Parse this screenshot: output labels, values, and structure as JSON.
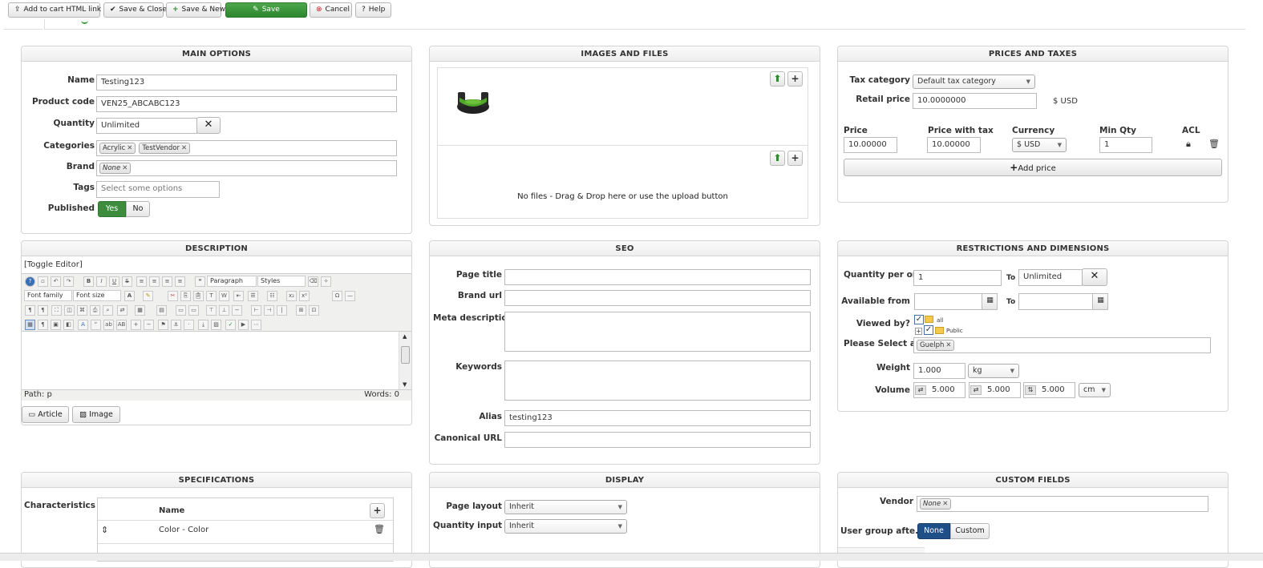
{
  "toolbar": {
    "add_to_cart": "Add to cart HTML link",
    "save_close": "Save & Close",
    "save_new": "Save & New",
    "save": "Save",
    "cancel": "Cancel",
    "help": "Help"
  },
  "main_options": {
    "title": "MAIN OPTIONS",
    "name_label": "Name",
    "name_value": "Testing123",
    "code_label": "Product code",
    "code_value": "VEN25_ABCABC123",
    "qty_label": "Quantity",
    "qty_value": "Unlimited",
    "categories_label": "Categories",
    "categories": [
      "Acrylic",
      "TestVendor"
    ],
    "brand_label": "Brand",
    "brand_value": "None",
    "tags_label": "Tags",
    "tags_placeholder": "Select some options",
    "published_label": "Published",
    "yes": "Yes",
    "no": "No"
  },
  "images": {
    "title": "IMAGES AND FILES",
    "no_files": "No files - Drag & Drop here or use the upload button"
  },
  "prices": {
    "title": "PRICES AND TAXES",
    "tax_label": "Tax category",
    "tax_value": "Default tax category",
    "retail_label": "Retail price",
    "retail_value": "10.0000000",
    "retail_currency": "$ USD",
    "col_price": "Price",
    "col_price_tax": "Price with tax",
    "col_currency": "Currency",
    "col_minqty": "Min Qty",
    "col_acl": "ACL",
    "row_price": "10.00000",
    "row_price_tax": "10.00000",
    "row_currency": "$ USD",
    "row_minqty": "1",
    "add_price": "Add price"
  },
  "description": {
    "title": "DESCRIPTION",
    "toggle": "[Toggle Editor]",
    "paragraph": "Paragraph",
    "styles": "Styles",
    "font_family": "Font family",
    "font_size": "Font size",
    "path": "Path: p",
    "words": "Words: 0",
    "article_btn": "Article",
    "image_btn": "Image"
  },
  "seo": {
    "title": "SEO",
    "page_title_label": "Page title",
    "brand_url_label": "Brand url",
    "meta_label": "Meta description",
    "keywords_label": "Keywords",
    "alias_label": "Alias",
    "alias_value": "testing123",
    "canonical_label": "Canonical URL"
  },
  "restrictions": {
    "title": "RESTRICTIONS AND DIMENSIONS",
    "qty_per_label": "Quantity per or...",
    "qty_per_from": "1",
    "to": "To",
    "qty_per_to": "Unlimited",
    "available_label": "Available from",
    "viewed_label": "Viewed by?",
    "viewed_all": "all",
    "viewed_public": "Public",
    "select_label": "Please Select a ...",
    "select_tag": "Guelph",
    "weight_label": "Weight",
    "weight_value": "1.000",
    "weight_unit": "kg",
    "volume_label": "Volume",
    "vol1": "5.000",
    "vol2": "5.000",
    "vol3": "5.000",
    "vol_unit": "cm"
  },
  "specifications": {
    "title": "SPECIFICATIONS",
    "characteristics_label": "Characteristics",
    "col_name": "Name",
    "row1": "Color - Color"
  },
  "display": {
    "title": "DISPLAY",
    "page_layout_label": "Page layout",
    "page_layout_value": "Inherit",
    "qty_input_label": "Quantity input",
    "qty_input_value": "Inherit"
  },
  "custom": {
    "title": "CUSTOM FIELDS",
    "vendor_label": "Vendor",
    "vendor_value": "None",
    "user_group_label": "User group afte...",
    "none": "None",
    "custom": "Custom"
  }
}
